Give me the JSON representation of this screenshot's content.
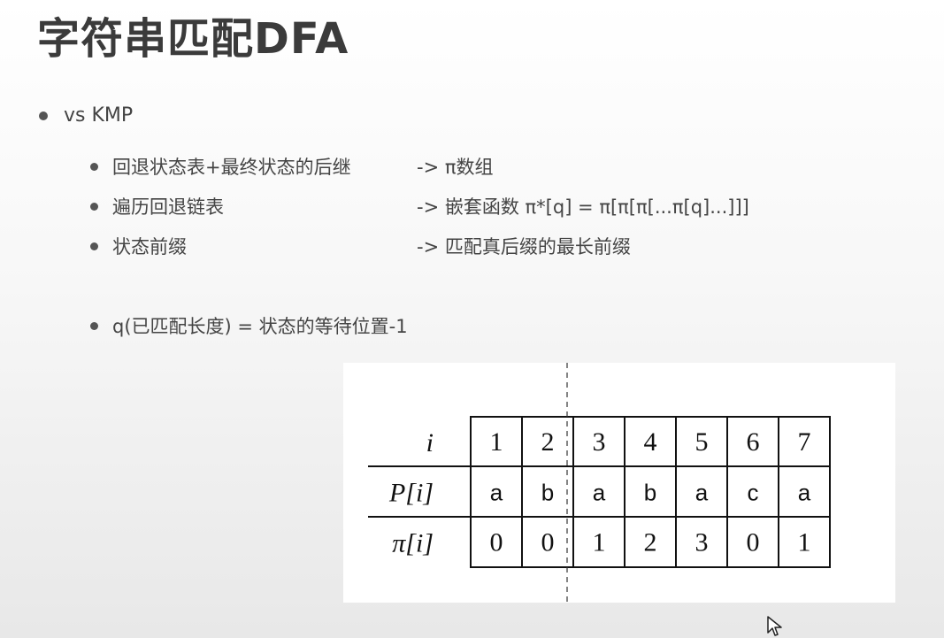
{
  "title": "字符串匹配DFA",
  "bullets": {
    "main": "vs KMP",
    "items": [
      {
        "left": "回退状态表+最终状态的后继",
        "right": "-> π数组"
      },
      {
        "left": "遍历回退链表",
        "right": "-> 嵌套函数 π*[q] = π[π[π[...π[q]...]]]"
      },
      {
        "left": "状态前缀",
        "right": "-> 匹配真后缀的最长前缀"
      }
    ],
    "extra": "q(已匹配长度) = 状态的等待位置-1"
  },
  "table": {
    "row_labels": [
      "i",
      "P[i]",
      "π[i]"
    ],
    "i": [
      "1",
      "2",
      "3",
      "4",
      "5",
      "6",
      "7"
    ],
    "P": [
      "a",
      "b",
      "a",
      "b",
      "a",
      "c",
      "a"
    ],
    "pi": [
      "0",
      "0",
      "1",
      "2",
      "3",
      "0",
      "1"
    ]
  }
}
